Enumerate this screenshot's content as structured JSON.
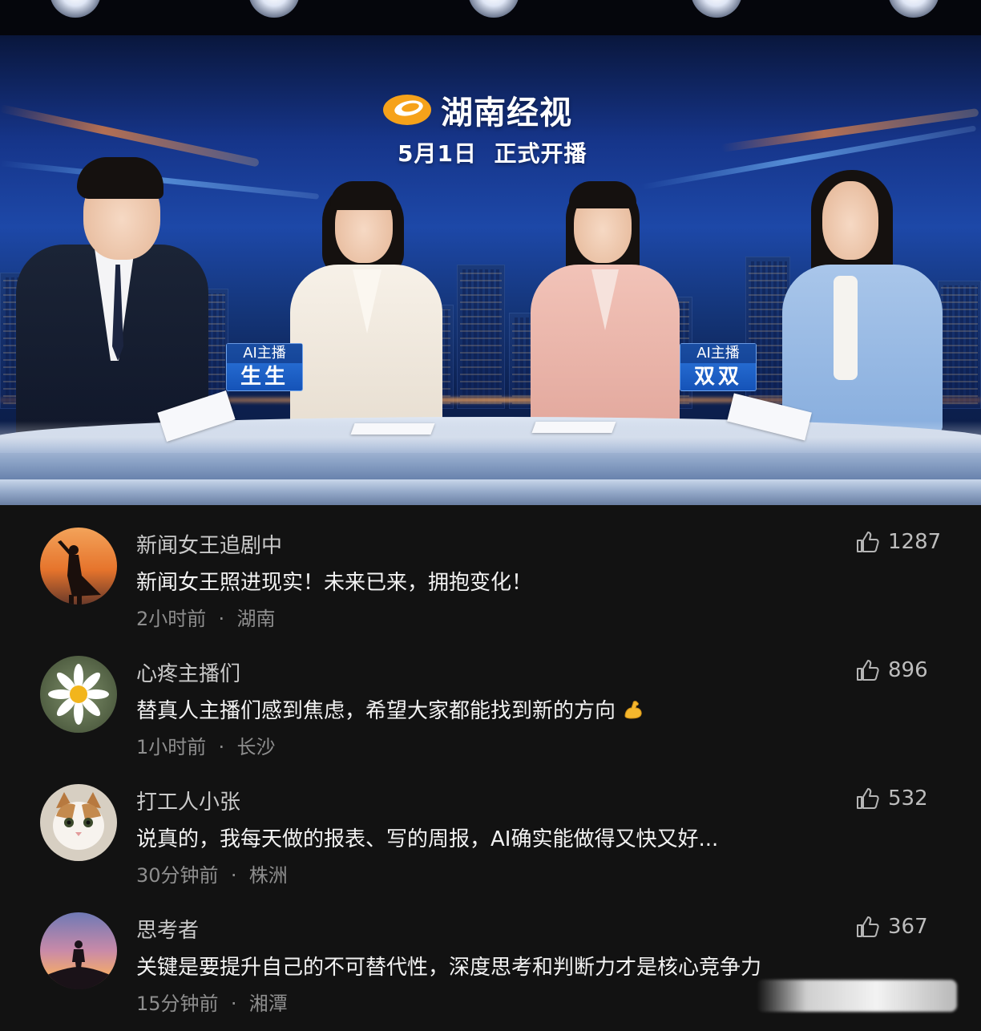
{
  "banner": {
    "channel_name": "湖南经视",
    "launch_text": "5月1日  正式开播",
    "tags": [
      {
        "label": "AI主播",
        "name": "生生"
      },
      {
        "label": "AI主播",
        "name": "双双"
      }
    ],
    "logo_color": "#f6a21a"
  },
  "comments": [
    {
      "username": "新闻女王追剧中",
      "text": "新闻女王照进现实！未来已来，拥抱变化！",
      "time": "2小时前",
      "location": "湖南",
      "likes": "1287",
      "avatar": "silhouette-caped-figure-sunset"
    },
    {
      "username": "心疼主播们",
      "text": "替真人主播们感到焦虑，希望大家都能找到新的方向",
      "emoji": "flexed-biceps-icon",
      "time": "1小时前",
      "location": "长沙",
      "likes": "896",
      "avatar": "daisy-flower"
    },
    {
      "username": "打工人小张",
      "text": "说真的，我每天做的报表、写的周报，AI确实能做得又快又好...",
      "time": "30分钟前",
      "location": "株洲",
      "likes": "532",
      "avatar": "white-cat"
    },
    {
      "username": "思考者",
      "text": "关键是要提升自己的不可替代性，深度思考和判断力才是核心竞争力",
      "time": "15分钟前",
      "location": "湘潭",
      "likes": "367",
      "avatar": "person-on-hill-sunset"
    }
  ],
  "meta_separator": "·",
  "like_icon": "thumbs-up-icon",
  "colors": {
    "background": "#121212",
    "username": "#c9c9c9",
    "text": "#f2f2f2",
    "meta": "#8e8e8e"
  }
}
